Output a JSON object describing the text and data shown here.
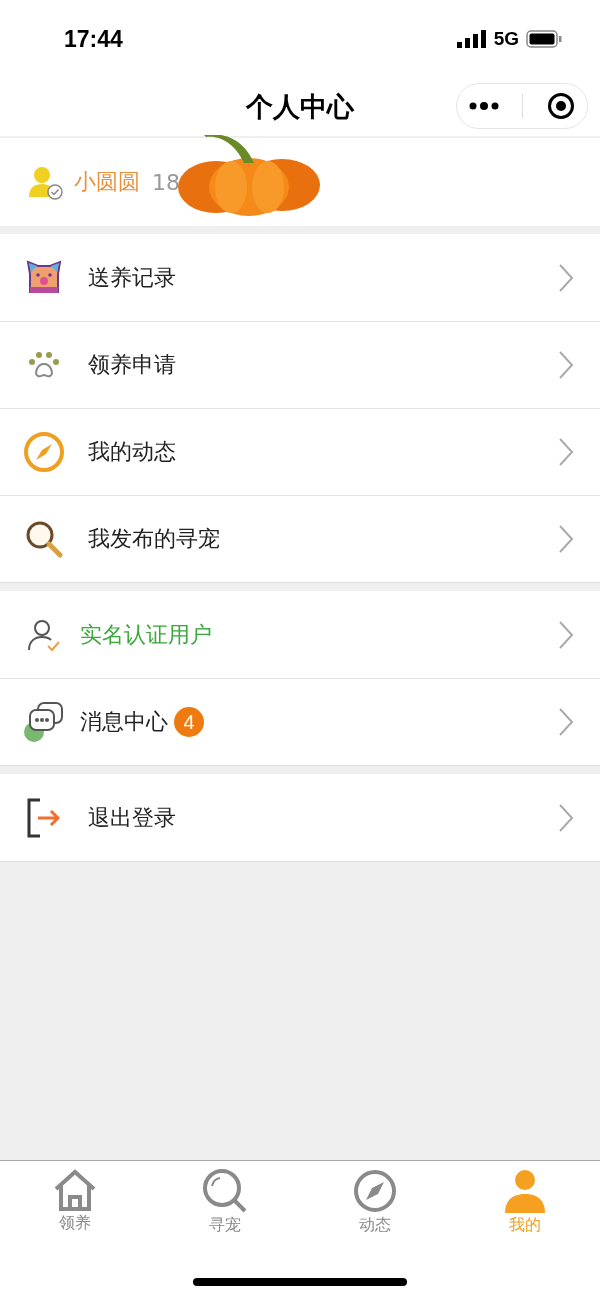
{
  "status_bar": {
    "time": "17:44",
    "network": "5G"
  },
  "header": {
    "title": "个人中心"
  },
  "user": {
    "name": "小圆圆",
    "phone": "18"
  },
  "groups": [
    {
      "items": [
        {
          "kind": "pet",
          "label": "送养记录",
          "verified": false
        },
        {
          "kind": "paw",
          "label": "领养申请",
          "verified": false
        },
        {
          "kind": "compass",
          "label": "我的动态",
          "verified": false
        },
        {
          "kind": "search",
          "label": "我发布的寻宠",
          "verified": false
        }
      ]
    },
    {
      "items": [
        {
          "kind": "user-check",
          "label": "实名认证用户",
          "verified": true
        },
        {
          "kind": "chat",
          "label": "消息中心",
          "verified": false,
          "badge": "4"
        }
      ]
    },
    {
      "items": [
        {
          "kind": "logout",
          "label": "退出登录",
          "verified": false
        }
      ]
    }
  ],
  "tabs": [
    {
      "kind": "home",
      "label": "领养",
      "selected": false
    },
    {
      "kind": "search",
      "label": "寻宠",
      "selected": false
    },
    {
      "kind": "compass",
      "label": "动态",
      "selected": false
    },
    {
      "kind": "person",
      "label": "我的",
      "selected": true
    }
  ]
}
